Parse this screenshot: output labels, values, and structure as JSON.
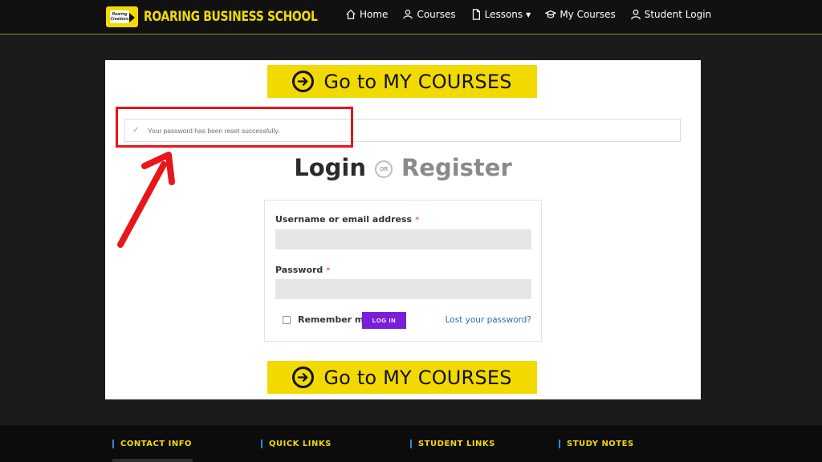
{
  "header": {
    "logo_badge_line1": "Roaring",
    "logo_badge_line2": "Creations",
    "logo_text": "ROARING BUSINESS SCHOOL",
    "nav": [
      {
        "label": "Home",
        "icon": "home-icon"
      },
      {
        "label": "Courses",
        "icon": "users-icon"
      },
      {
        "label": "Lessons",
        "icon": "document-icon"
      },
      {
        "label": "My Courses",
        "icon": "graduation-cap-icon"
      },
      {
        "label": "Student Login",
        "icon": "user-icon"
      }
    ]
  },
  "cta": {
    "label": "Go to MY COURSES",
    "icon": "arrow-circle-right-icon"
  },
  "notice": {
    "text": "Your password has been reset successfully.",
    "icon": "check-icon"
  },
  "tabs": {
    "login": "Login",
    "or": "OR",
    "register": "Register"
  },
  "form": {
    "username_label": "Username or email address",
    "password_label": "Password",
    "required_mark": "*",
    "username_value": "",
    "password_value": "",
    "remember_label": "Remember me",
    "login_button": "LOG IN",
    "lost_password": "Lost your password?"
  },
  "footer": {
    "columns": [
      "CONTACT INFO",
      "QUICK LINKS",
      "STUDENT LINKS",
      "STUDY NOTES"
    ]
  },
  "colors": {
    "brand_yellow": "#f2da00",
    "login_button": "#7a1fd9",
    "annotation_red": "#e8151b",
    "link_blue": "#2d6bb3",
    "footer_accent": "#2a8bd6"
  }
}
